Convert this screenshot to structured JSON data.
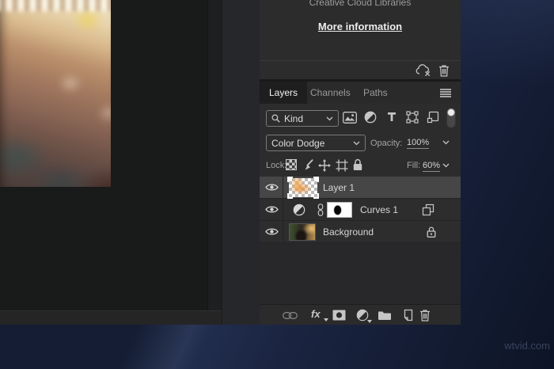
{
  "libraries": {
    "title": "Creative Cloud Libraries",
    "link_label": "More information"
  },
  "tabs": [
    {
      "label": "Layers",
      "active": true
    },
    {
      "label": "Channels",
      "active": false
    },
    {
      "label": "Paths",
      "active": false
    }
  ],
  "filter": {
    "kind_label": "Kind"
  },
  "blend": {
    "mode": "Color Dodge",
    "opacity_label": "Opacity:",
    "opacity_value": "100%"
  },
  "lock": {
    "label": "Lock:",
    "fill_label": "Fill:",
    "fill_value": "60%"
  },
  "layers": [
    {
      "name": "Layer 1",
      "type": "pixel",
      "selected": true,
      "visible": true
    },
    {
      "name": "Curves 1",
      "type": "adjustment",
      "selected": false,
      "visible": true
    },
    {
      "name": "Background",
      "type": "background",
      "selected": false,
      "visible": true,
      "locked": true
    }
  ],
  "toolbar": {
    "fx_label": "fx"
  },
  "watermark": {
    "text": "wtvid.com"
  },
  "icons": {
    "library-sync-error-icon": "cloud with x",
    "trash-icon": "trash can",
    "panel-menu-icon": "hamburger lines",
    "search-icon": "magnifier",
    "chevron-down-icon": "v",
    "pixel-filter-icon": "picture frame",
    "adjustment-filter-icon": "half circle",
    "type-filter-icon": "letter T",
    "shape-filter-icon": "square with anchors",
    "smart-object-filter-icon": "page with badge",
    "filter-toggle-icon": "vertical pill switch",
    "lock-transparency-icon": "checkerboard",
    "lock-paint-icon": "brush",
    "lock-position-icon": "move cross",
    "lock-artboard-icon": "crop marks",
    "lock-all-icon": "padlock",
    "eye-icon": "visibility eye",
    "link-icon": "chain links",
    "mask-icon": "rectangle with circle",
    "folder-icon": "group folder",
    "new-layer-icon": "page with folded corner",
    "clip-squares-icon": "two overlapping squares",
    "background-lock-icon": "padlock outline"
  },
  "colors": {
    "panel_bg": "#2c2c2c",
    "selected_row": "#464646",
    "desktop_navy": "#121a2e",
    "photo_orange": "#e89442"
  }
}
